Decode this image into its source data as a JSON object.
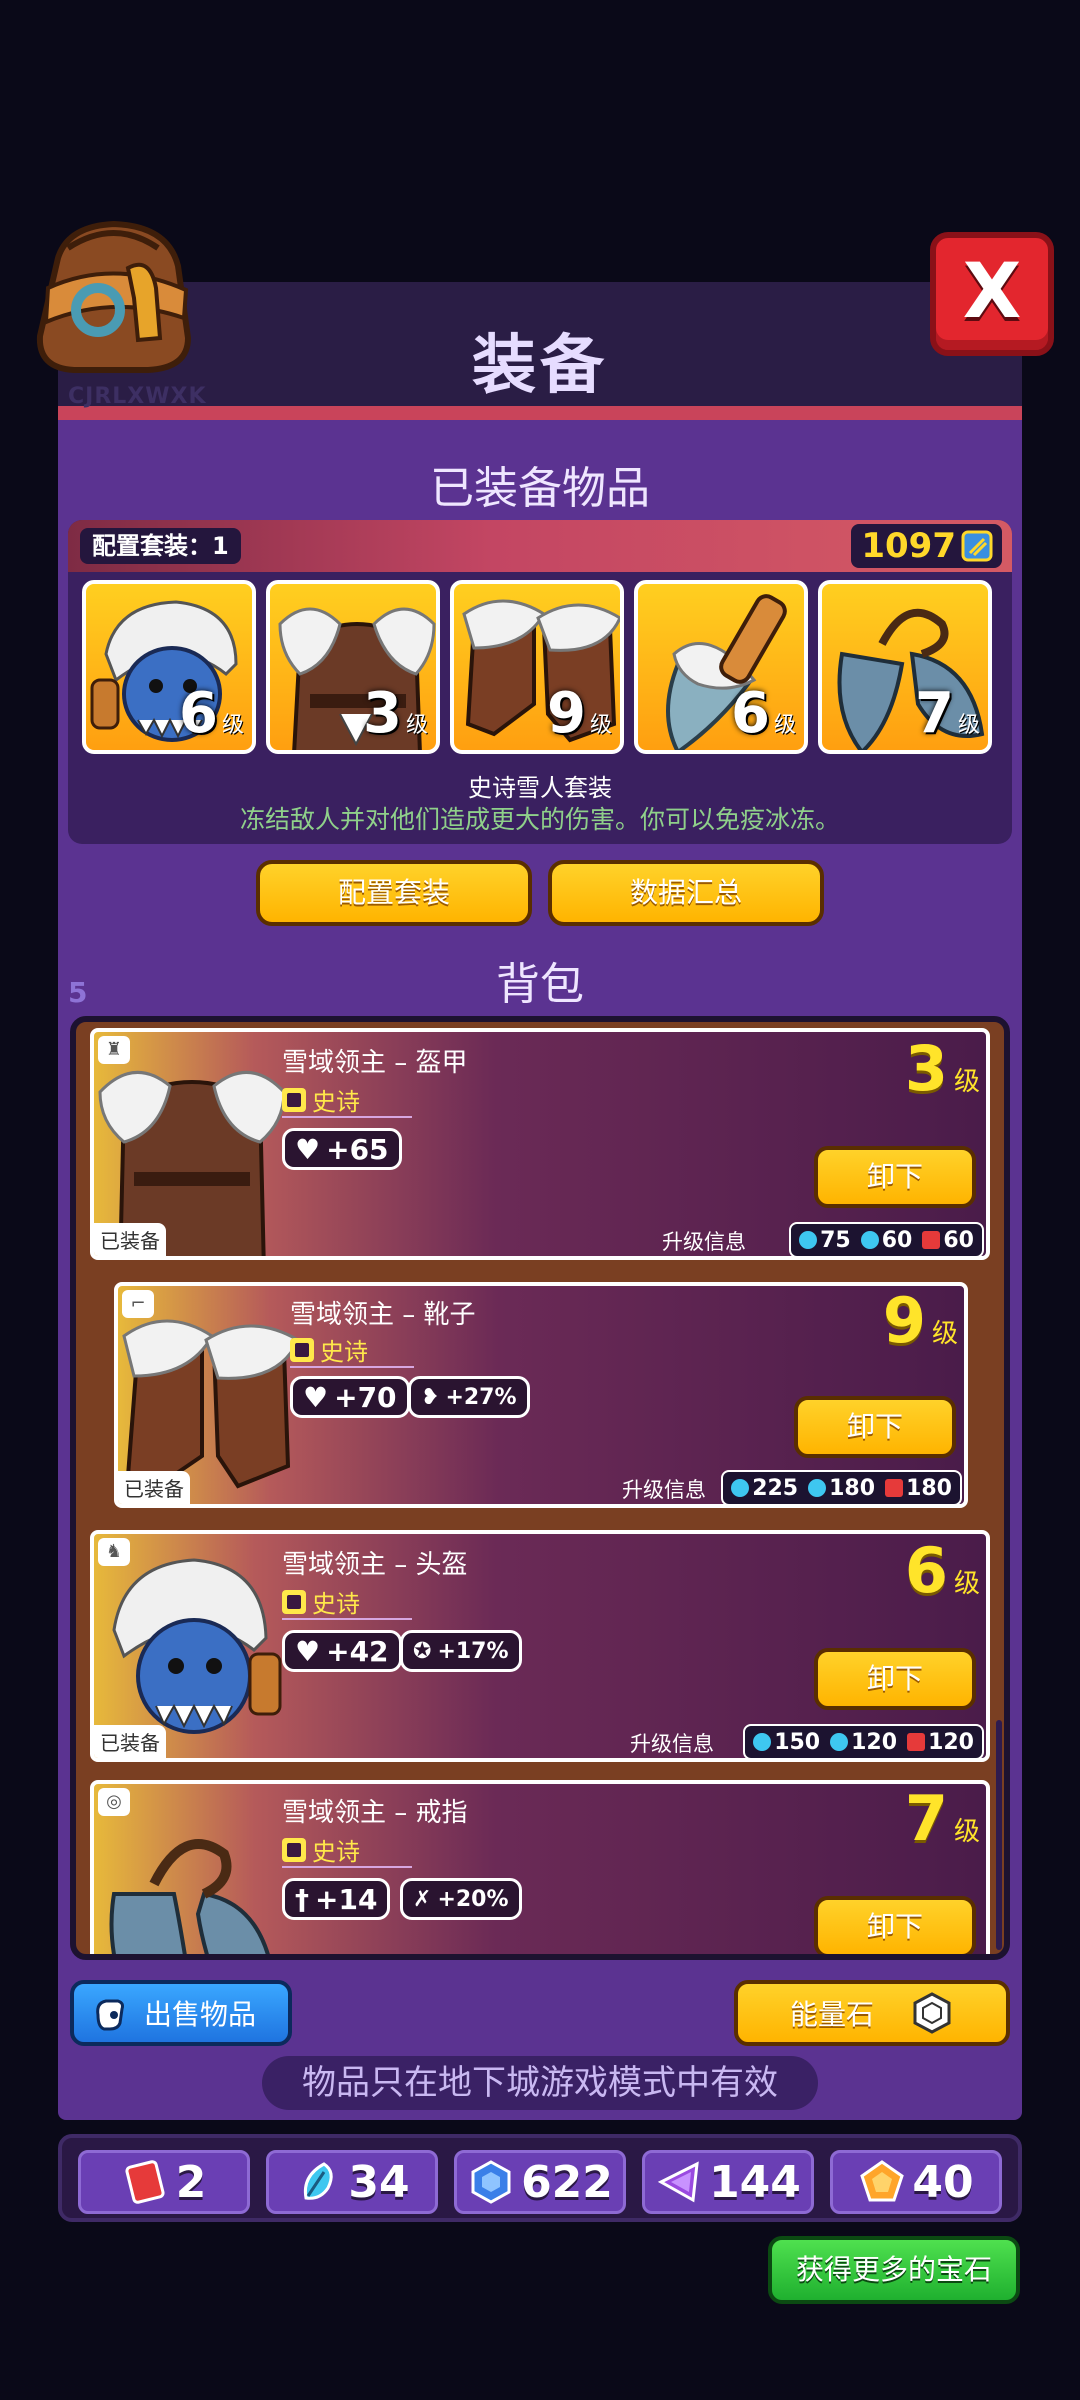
{
  "header": {
    "title": "装备",
    "player_code": "CJRLXWXK",
    "close_label": "X"
  },
  "equipped": {
    "section_title": "已装备物品",
    "preset_label": "配置套装：1",
    "power": "1097",
    "slots": [
      {
        "level": "6",
        "unit": "级",
        "item": "helmet"
      },
      {
        "level": "3",
        "unit": "级",
        "item": "armor"
      },
      {
        "level": "9",
        "unit": "级",
        "item": "boots"
      },
      {
        "level": "6",
        "unit": "级",
        "item": "weapon"
      },
      {
        "level": "7",
        "unit": "级",
        "item": "ring"
      }
    ],
    "set_name": "史诗雪人套装",
    "set_desc": "冻结敌人并对他们造成更大的伤害。你可以免疫冰冻。"
  },
  "actions": {
    "preset_button": "配置套装",
    "summary_button": "数据汇总"
  },
  "bag": {
    "section_title": "背包",
    "count": "5",
    "items": [
      {
        "name": "雪域领主 – 盔甲",
        "rarity": "史诗",
        "level": "3",
        "unit": "级",
        "stats": [
          "+65"
        ],
        "stat_icons": [
          "heart-icon"
        ],
        "equipped_tag": "已装备",
        "unequip": "卸下",
        "upgrade_label": "升级信息",
        "costs": [
          "75",
          "60",
          "60"
        ]
      },
      {
        "name": "雪域领主 – 靴子",
        "rarity": "史诗",
        "level": "9",
        "unit": "级",
        "stats": [
          "+70",
          "+27%"
        ],
        "stat_icons": [
          "heart-icon",
          "speed-icon"
        ],
        "equipped_tag": "已装备",
        "unequip": "卸下",
        "upgrade_label": "升级信息",
        "costs": [
          "225",
          "180",
          "180"
        ]
      },
      {
        "name": "雪域领主 – 头盔",
        "rarity": "史诗",
        "level": "6",
        "unit": "级",
        "stats": [
          "+42",
          "+17%"
        ],
        "stat_icons": [
          "heart-icon",
          "pentagram-icon"
        ],
        "equipped_tag": "已装备",
        "unequip": "卸下",
        "upgrade_label": "升级信息",
        "costs": [
          "150",
          "120",
          "120"
        ]
      },
      {
        "name": "雪域领主 – 戒指",
        "rarity": "史诗",
        "level": "7",
        "unit": "级",
        "stats": [
          "+14",
          "+20%"
        ],
        "stat_icons": [
          "sword-icon",
          "crit-icon"
        ],
        "unequip": "卸下"
      }
    ]
  },
  "footer": {
    "sell_button": "出售物品",
    "energy_button": "能量石",
    "notice": "物品只在地下城游戏模式中有效",
    "gem_button": "获得更多的宝石"
  },
  "currencies": [
    {
      "icon": "red-card-icon",
      "value": "2",
      "color": "#e63a3a"
    },
    {
      "icon": "blue-feather-icon",
      "value": "34",
      "color": "#3ec7f0"
    },
    {
      "icon": "blue-hex-gem-icon",
      "value": "622",
      "color": "#3a7fe8"
    },
    {
      "icon": "purple-triangle-icon",
      "value": "144",
      "color": "#9a4ae0"
    },
    {
      "icon": "orange-pentagon-icon",
      "value": "40",
      "color": "#ffa52a"
    }
  ]
}
